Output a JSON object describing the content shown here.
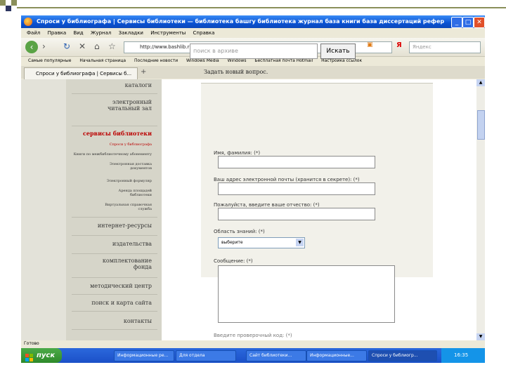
{
  "window": {
    "title": "Спроси у библиографа | Сервисы библиотеки — библиотека башгу библиотека журнал база книги база диссертаций реферативный журна...",
    "controls": {
      "minimize": "_",
      "maximize": "□",
      "close": "✕"
    }
  },
  "menu": [
    "Файл",
    "Правка",
    "Вид",
    "Журнал",
    "Закладки",
    "Инструменты",
    "Справка"
  ],
  "nav": {
    "url": "http://www.bashlib.ru/service.php",
    "search_placeholder": "Яндекс",
    "back_icon": "back-arrow-icon",
    "reload_icon": "reload-icon",
    "stop_icon": "stop-icon",
    "home_icon": "home-icon"
  },
  "bookmarks": [
    "Самые популярные",
    "Начальная страница",
    "Последние новости",
    "Windows Media",
    "Windows",
    "Бесплатная почта Hotmail",
    "Настройка ссылок"
  ],
  "tab": {
    "label": "Спроси у библиографа | Сервисы б...",
    "new_tab": "+"
  },
  "sidebar": {
    "items": [
      {
        "label": "каталоги"
      },
      {
        "label": "электронный читальный зал"
      },
      {
        "label": "сервисы библиотеки",
        "active": true
      },
      {
        "label": "Спроси у библиографа"
      },
      {
        "label": "Книги по межбиблиотечному абонементу"
      },
      {
        "label": "Электронная доставка документов"
      },
      {
        "label": "Электронный формуляр"
      },
      {
        "label": "Аренда площадей библиотеки"
      },
      {
        "label": "Виртуальная справочная служба"
      },
      {
        "label": "интернет-ресурсы"
      },
      {
        "label": "издательства"
      },
      {
        "label": "комплектование фонда"
      },
      {
        "label": "методический центр"
      },
      {
        "label": "поиск и карта сайта"
      },
      {
        "label": "контакты"
      }
    ]
  },
  "main": {
    "archive_search": {
      "placeholder": "поиск в архиве",
      "button": "Искать"
    },
    "form_title": "Задать новый вопрос.",
    "fields": [
      {
        "label": "Имя, фамилия: (*)"
      },
      {
        "label": "Ваш адрес электронной почты (хранится в секрете): (*)"
      },
      {
        "label": "Пожалуйста, введите ваше отчество: (*)"
      },
      {
        "label": "Область знаний: (*)",
        "select_value": "выберите"
      },
      {
        "label": "Сообщение: (*)"
      },
      {
        "label": "Введите проверочный код: (*)"
      }
    ]
  },
  "statusbar": {
    "text": "Готово"
  },
  "taskbar": {
    "start_label": "пуск",
    "items": [
      {
        "label": "Информационные ре..."
      },
      {
        "label": "Для отдела"
      },
      {
        "label": "Сайт библиотеки..."
      },
      {
        "label": "Информационные..."
      },
      {
        "label": "Спроси у библиогр...",
        "active": true
      }
    ],
    "clock": "16:35"
  }
}
